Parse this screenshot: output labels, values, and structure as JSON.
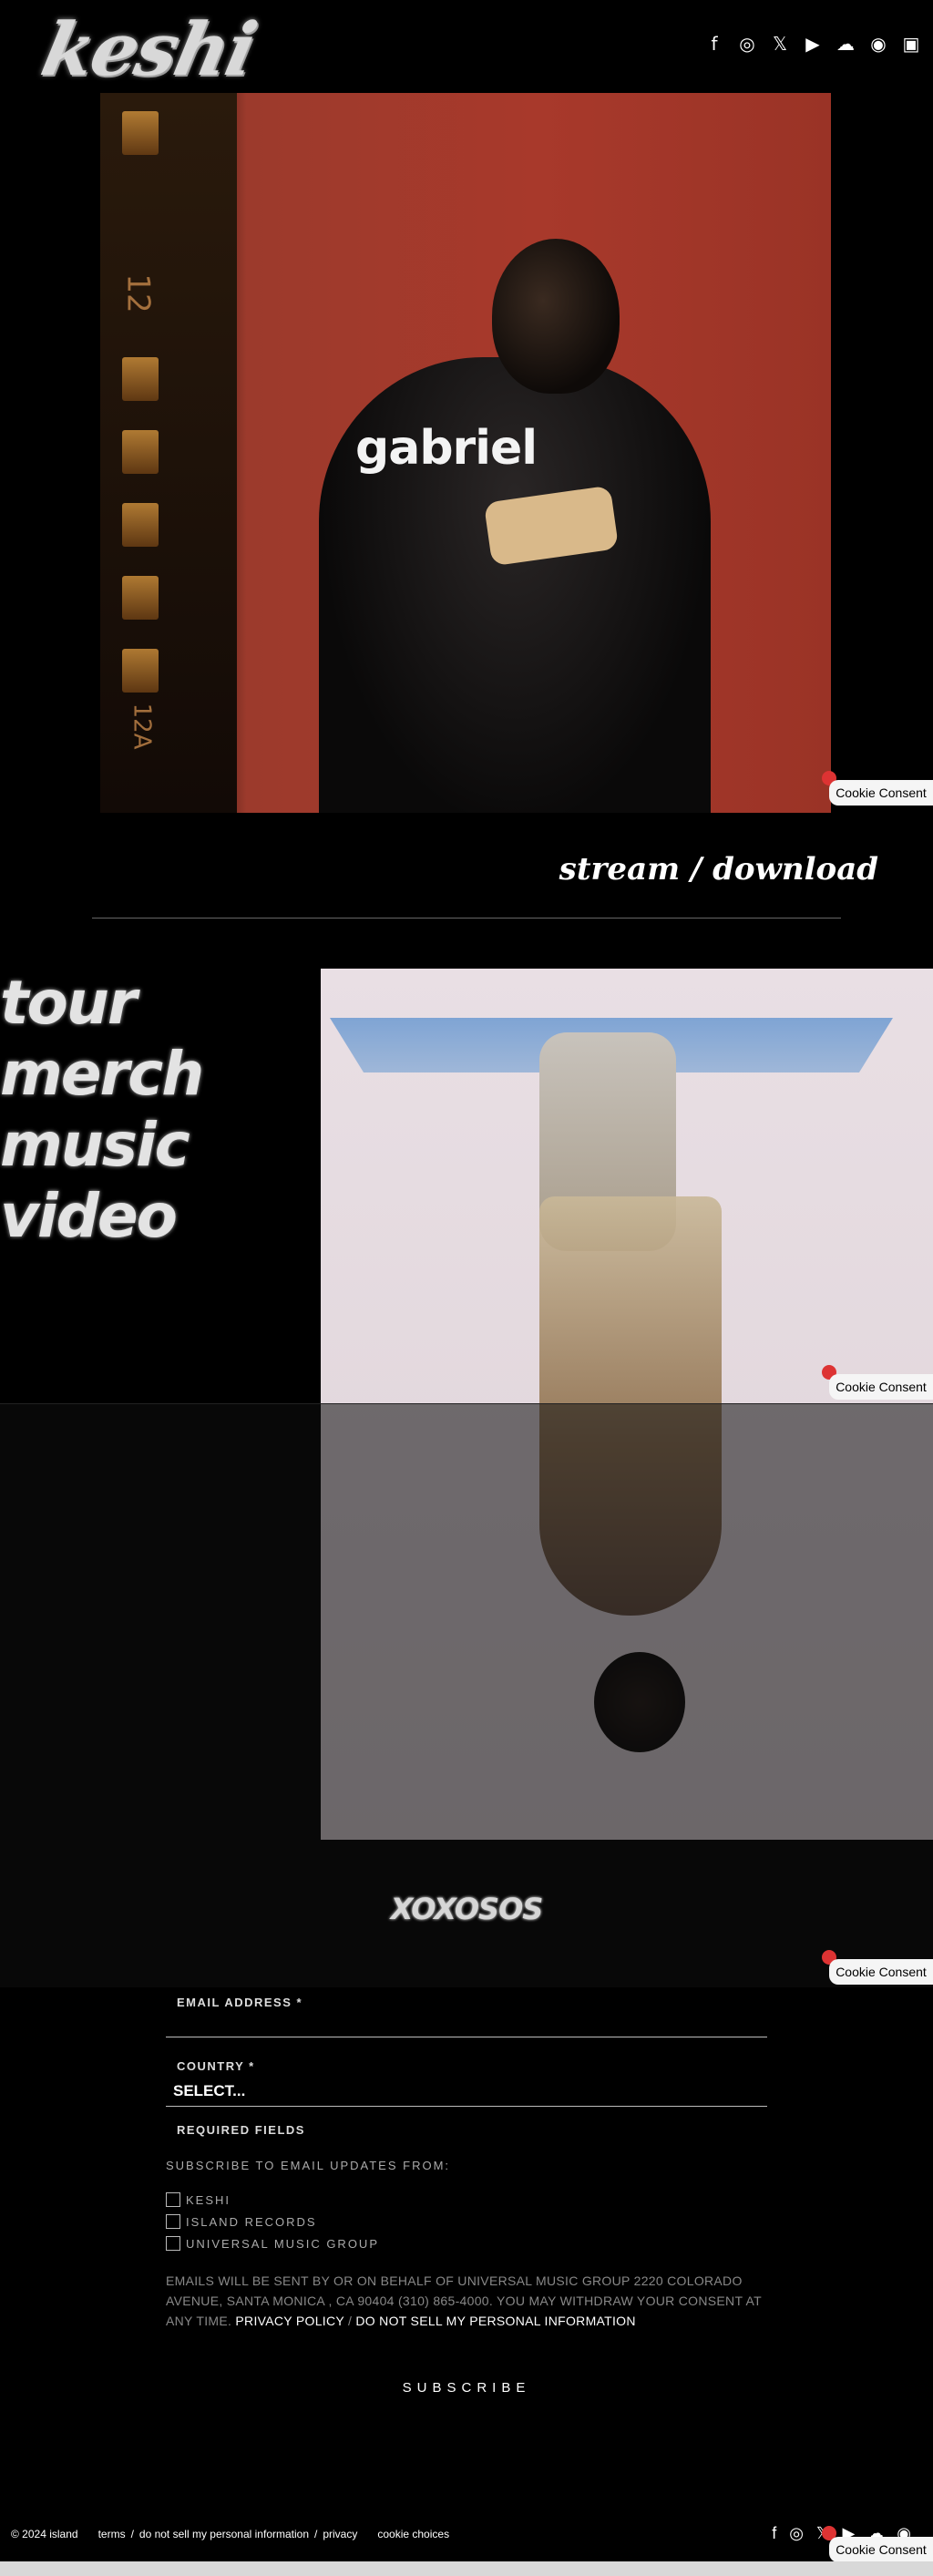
{
  "header": {
    "logo_text": "keshi",
    "social": [
      {
        "icon": "facebook-icon",
        "glyph": "f"
      },
      {
        "icon": "instagram-icon",
        "glyph": "◎"
      },
      {
        "icon": "x-twitter-icon",
        "glyph": "𝕏"
      },
      {
        "icon": "youtube-icon",
        "glyph": "▶"
      },
      {
        "icon": "soundcloud-icon",
        "glyph": "☁"
      },
      {
        "icon": "spotify-icon",
        "glyph": "◉"
      },
      {
        "icon": "store-icon",
        "glyph": "▣"
      }
    ]
  },
  "hero": {
    "album_title": "gabriel",
    "film_numbers": [
      "12",
      "12A"
    ]
  },
  "stream": {
    "label": "stream / download"
  },
  "nav": {
    "items": [
      "tour",
      "merch",
      "music",
      "video"
    ]
  },
  "secondary_title": "XOXOSOS",
  "cookie": {
    "label": "Cookie Consent"
  },
  "form": {
    "email_label": "EMAIL ADDRESS *",
    "country_label": "COUNTRY *",
    "country_value": "SELECT...",
    "required_note": "REQUIRED FIELDS",
    "subscribe_heading": "SUBSCRIBE TO EMAIL UPDATES FROM:",
    "options": [
      "KESHI",
      "ISLAND RECORDS",
      "UNIVERSAL MUSIC GROUP"
    ],
    "legal_text": "EMAILS WILL BE SENT BY OR ON BEHALF OF UNIVERSAL MUSIC GROUP 2220 COLORADO AVENUE, SANTA MONICA , CA 90404 (310) 865-4000. YOU MAY WITHDRAW YOUR CONSENT AT ANY TIME.",
    "privacy_link": "PRIVACY POLICY",
    "separator": "/",
    "dns_link": "DO NOT SELL MY PERSONAL INFORMATION",
    "submit_label": "SUBSCRIBE"
  },
  "footer": {
    "copyright": "© 2024 island",
    "links": [
      "terms",
      "/",
      "do not sell my personal information",
      "/",
      "privacy"
    ],
    "cookie_choices": "cookie choices"
  }
}
